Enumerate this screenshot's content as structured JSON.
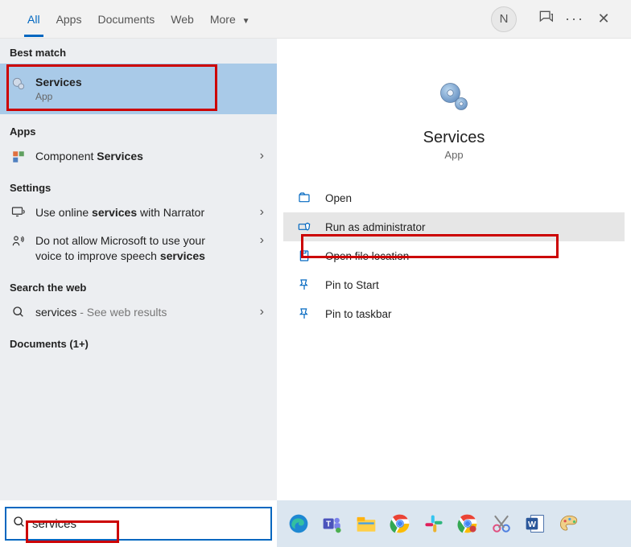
{
  "tabs": {
    "all": "All",
    "apps": "Apps",
    "documents": "Documents",
    "web": "Web",
    "more": "More"
  },
  "user_initial": "N",
  "sections": {
    "best_match": "Best match",
    "apps": "Apps",
    "settings": "Settings",
    "search_web": "Search the web",
    "documents": "Documents (1+)"
  },
  "best_match": {
    "name": "Services",
    "type": "App"
  },
  "apps_results": {
    "component_pre": "Component ",
    "component_bold": "Services"
  },
  "settings_results": {
    "narrator_pre": "Use online ",
    "narrator_bold": "services",
    "narrator_post": " with Narrator",
    "speech_line1_pre": "Do not allow Microsoft to use your",
    "speech_line2_pre": "voice to improve speech ",
    "speech_line2_bold": "services"
  },
  "web_results": {
    "term": "services",
    "hint": " - See web results"
  },
  "detail": {
    "title": "Services",
    "subtitle": "App",
    "actions": {
      "open": "Open",
      "run_admin": "Run as administrator",
      "open_loc": "Open file location",
      "pin_start": "Pin to Start",
      "pin_taskbar": "Pin to taskbar"
    }
  },
  "search": {
    "value": "services"
  }
}
